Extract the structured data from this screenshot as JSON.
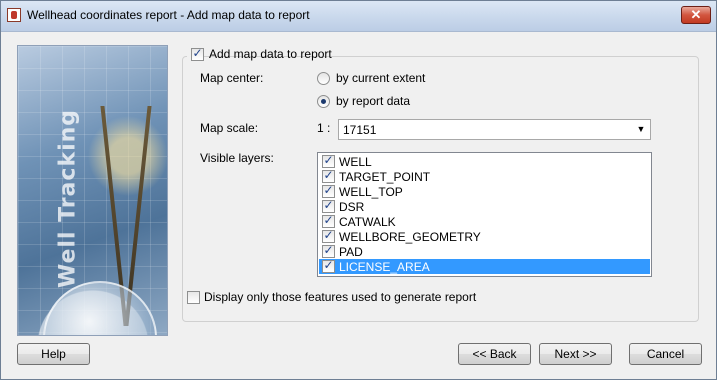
{
  "window": {
    "title": "Wellhead coordinates report - Add map data to report",
    "close_label": "✕"
  },
  "banner": {
    "text": "Well Tracking"
  },
  "add_map_data": {
    "label": "Add map data to report",
    "checked": true
  },
  "map_center": {
    "label": "Map center:",
    "options": [
      {
        "label": "by current extent",
        "selected": false
      },
      {
        "label": "by report data",
        "selected": true
      }
    ]
  },
  "map_scale": {
    "label": "Map scale:",
    "prefix": "1 :",
    "value": "17151"
  },
  "visible_layers": {
    "label": "Visible layers:",
    "items": [
      {
        "label": "WELL",
        "checked": true
      },
      {
        "label": "TARGET_POINT",
        "checked": true
      },
      {
        "label": "WELL_TOP",
        "checked": true
      },
      {
        "label": "DSR",
        "checked": true
      },
      {
        "label": "CATWALK",
        "checked": true
      },
      {
        "label": "WELLBORE_GEOMETRY",
        "checked": true
      },
      {
        "label": "PAD",
        "checked": true
      },
      {
        "label": "LICENSE_AREA",
        "checked": true,
        "selected": true
      }
    ]
  },
  "display_only": {
    "label": "Display only those features used to generate report",
    "checked": false
  },
  "buttons": {
    "help": "Help",
    "back": "<< Back",
    "next": "Next >>",
    "cancel": "Cancel"
  }
}
